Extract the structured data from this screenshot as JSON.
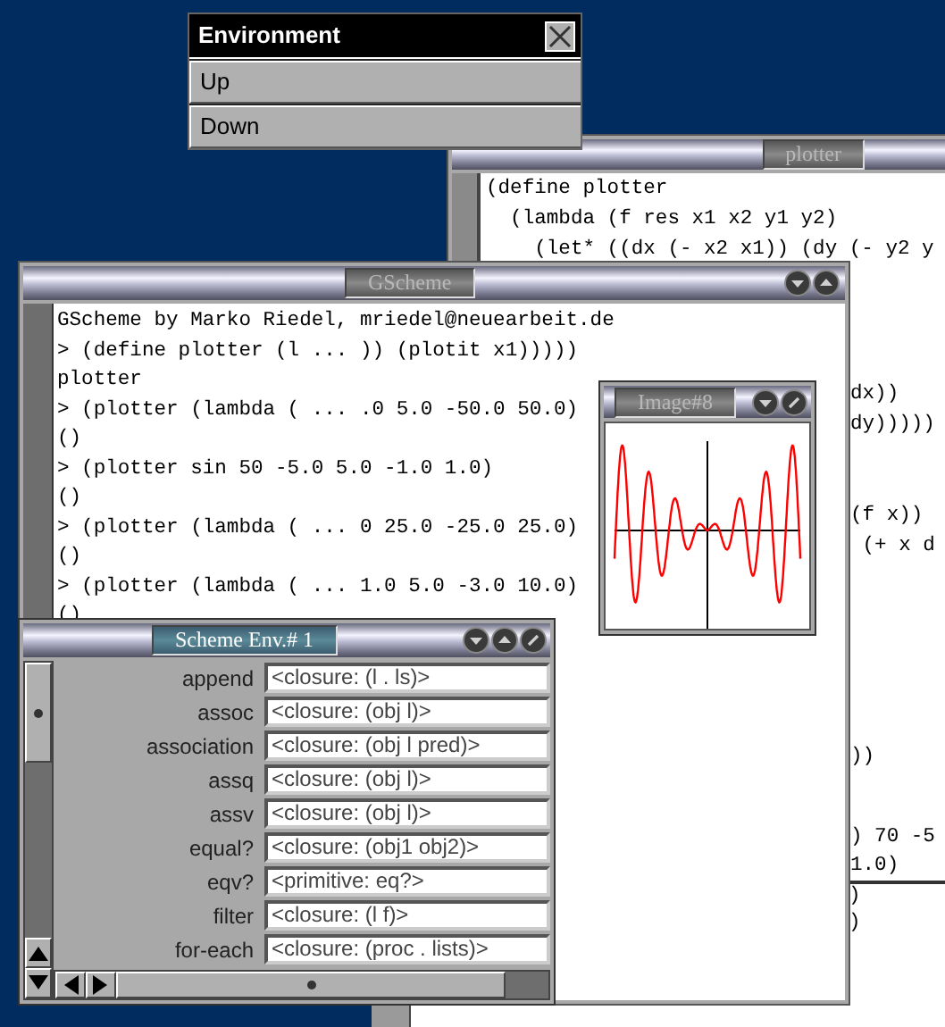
{
  "environment_menu": {
    "title": "Environment",
    "items": [
      "Up",
      "Down"
    ]
  },
  "plotter_window": {
    "title": "plotter",
    "lines": [
      "(define plotter",
      "  (lambda (f res x1 x2 y1 y2)",
      "    (let* ((dx (- x2 x1)) (dy (- y2 y"
    ],
    "fragments": [
      "dx))",
      "dy)))))",
      "(f x))",
      " (+ x d",
      "))",
      ") 70 -5",
      "1.0)"
    ]
  },
  "gscheme_window": {
    "title": "GScheme",
    "lines": [
      "GScheme by Marko Riedel, mriedel@neuearbeit.de",
      "> (define plotter (l ... )) (plotit x1)))))",
      "plotter",
      "> (plotter (lambda ( ... .0 5.0 -50.0 50.0)",
      "()",
      "> (plotter sin 50 -5.0 5.0 -1.0 1.0)",
      "()",
      "> (plotter (lambda ( ... 0 25.0 -25.0 25.0)",
      "()",
      "> (plotter (lambda ( ... 1.0 5.0 -3.0 10.0)",
      "()"
    ]
  },
  "image_window": {
    "title": "Image#8"
  },
  "env_window": {
    "title": "Scheme Env.# 1",
    "rows": [
      {
        "name": "append",
        "value": "<closure: (l . ls)>"
      },
      {
        "name": "assoc",
        "value": "<closure: (obj l)>"
      },
      {
        "name": "association",
        "value": "<closure: (obj l pred)>"
      },
      {
        "name": "assq",
        "value": "<closure: (obj l)>"
      },
      {
        "name": "assv",
        "value": "<closure: (obj l)>"
      },
      {
        "name": "equal?",
        "value": "<closure: (obj1 obj2)>"
      },
      {
        "name": "eqv?",
        "value": "<primitive: eq?>"
      },
      {
        "name": "filter",
        "value": "<closure: (l f)>"
      },
      {
        "name": "for-each",
        "value": "<closure: (proc . lists)>"
      }
    ]
  },
  "lower_window": {
    "fragments": [
      ")",
      ")"
    ]
  }
}
